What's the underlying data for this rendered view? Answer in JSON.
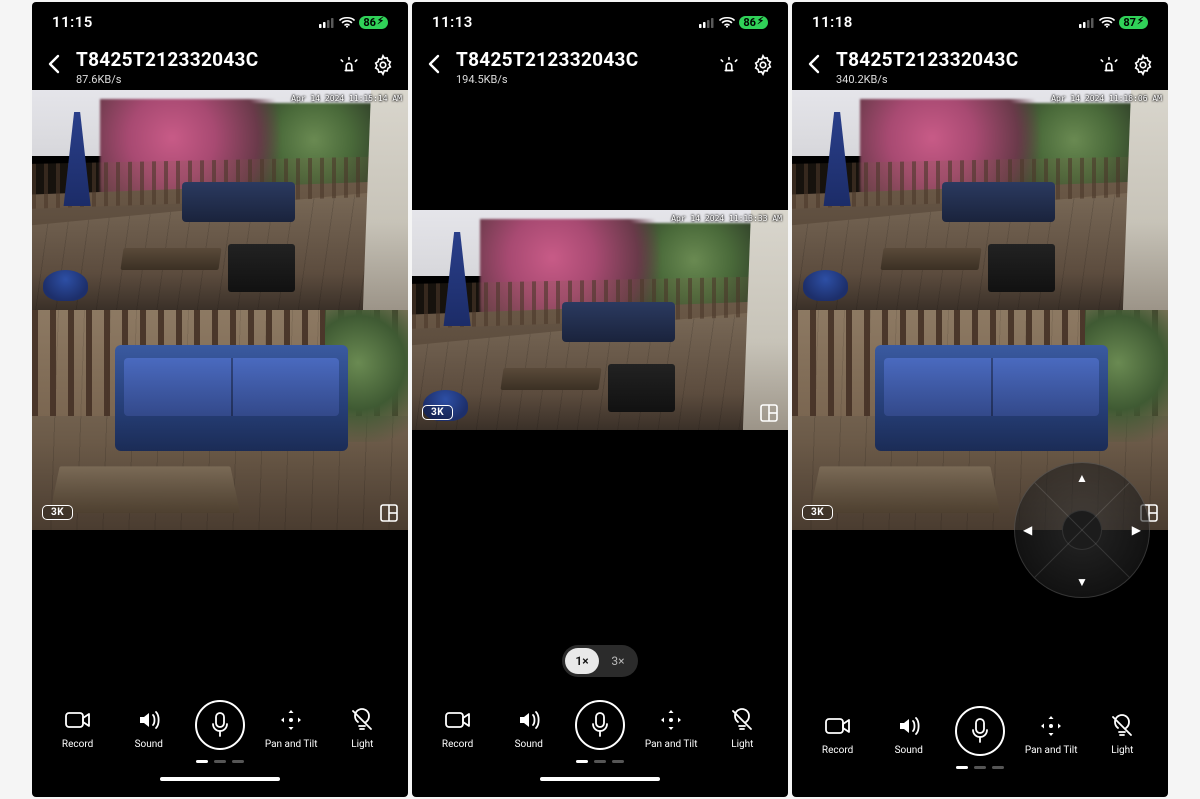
{
  "battery_icon_bolt": "⚡︎",
  "screens": [
    {
      "status": {
        "time": "11:15",
        "battery": "86"
      },
      "header": {
        "title": "T8425T212332043C",
        "bitrate": "87.6KB/s"
      },
      "feed_wide": {
        "timestamp": "Apr 14 2024  11:15:14 AM"
      },
      "feed_tele": {
        "res_badge": "3K"
      },
      "controls": {
        "record": "Record",
        "sound": "Sound",
        "mic": "",
        "ptz": "Pan and Tilt",
        "light": "Light"
      },
      "has_home_indicator": true
    },
    {
      "status": {
        "time": "11:13",
        "battery": "86"
      },
      "header": {
        "title": "T8425T212332043C",
        "bitrate": "194.5KB/s"
      },
      "feed_wide": {
        "timestamp": "Apr 14 2024  11:13:33 AM",
        "res_badge": "3K"
      },
      "zoom": {
        "opt1": "1×",
        "opt3": "3×",
        "active": "1×"
      },
      "controls": {
        "record": "Record",
        "sound": "Sound",
        "mic": "",
        "ptz": "Pan and Tilt",
        "light": "Light"
      },
      "has_home_indicator": true
    },
    {
      "status": {
        "time": "11:18",
        "battery": "87"
      },
      "header": {
        "title": "T8425T212332043C",
        "bitrate": "340.2KB/s"
      },
      "feed_wide": {
        "timestamp": "Apr 14 2024  11:18:06 AM"
      },
      "feed_tele": {
        "res_badge": "3K"
      },
      "controls": {
        "record": "Record",
        "sound": "Sound",
        "mic": "",
        "ptz": "Pan and Tilt",
        "light": "Light"
      },
      "has_home_indicator": false,
      "ptz_dial": true
    }
  ]
}
